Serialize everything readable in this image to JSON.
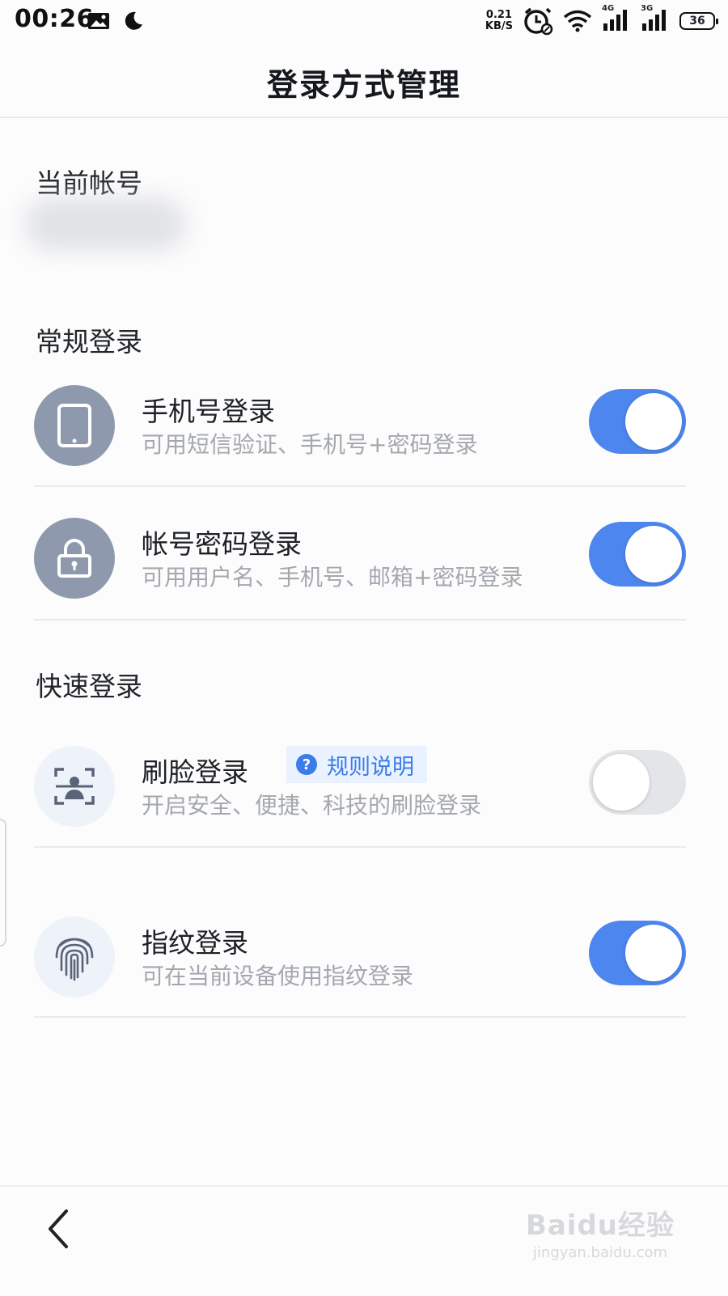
{
  "status_bar": {
    "time": "00:26",
    "net_speed_value": "0.21",
    "net_speed_unit": "KB/S",
    "sig1_label": "4G",
    "sig2_label": "3G",
    "battery": "36"
  },
  "header": {
    "title": "登录方式管理"
  },
  "current_account": {
    "label": "当前帐号"
  },
  "sections": {
    "regular": "常规登录",
    "quick": "快速登录"
  },
  "methods": {
    "phone": {
      "title": "手机号登录",
      "desc": "可用短信验证、手机号+密码登录",
      "enabled": true,
      "icon": "phone-icon"
    },
    "password": {
      "title": "帐号密码登录",
      "desc": "可用用户名、手机号、邮箱+密码登录",
      "enabled": true,
      "icon": "lock-icon"
    },
    "face": {
      "title": "刷脸登录",
      "desc": "开启安全、便捷、科技的刷脸登录",
      "enabled": false,
      "icon": "face-scan-icon",
      "rule_link": "规则说明"
    },
    "fingerprint": {
      "title": "指纹登录",
      "desc": "可在当前设备使用指纹登录",
      "enabled": true,
      "icon": "fingerprint-icon"
    }
  },
  "watermark": {
    "logo": "Baidu经验",
    "url": "jingyan.baidu.com"
  },
  "colors": {
    "accent": "#4c86ee",
    "icon_gray": "#8e99ad",
    "icon_light_bg": "#eef2f9",
    "toggle_off": "#e4e5e8"
  }
}
